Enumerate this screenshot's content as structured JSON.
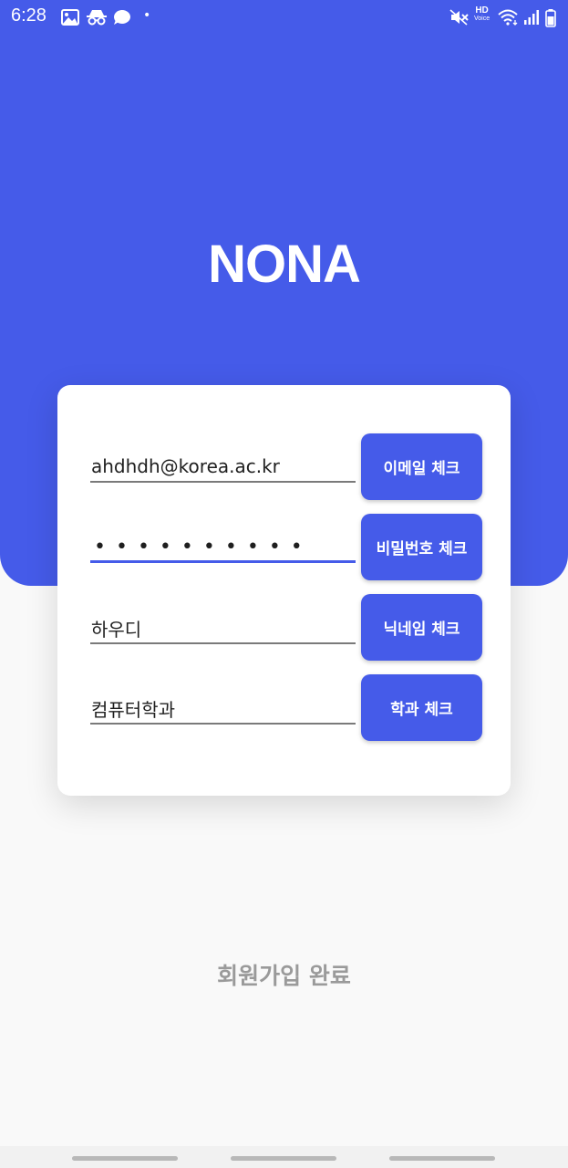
{
  "status_bar": {
    "time": "6:28",
    "hd_label": "HD",
    "voice_label": "Voice",
    "icons": [
      "gallery-icon",
      "incognito-icon",
      "chat-bubble-icon",
      "mute-icon",
      "wifi-icon",
      "signal-icon",
      "battery-icon"
    ]
  },
  "app": {
    "title": "NONA",
    "accent_color": "#455be9"
  },
  "form": {
    "email": {
      "value": "ahdhdh@korea.ac.kr",
      "button_label": "이메일 체크"
    },
    "password": {
      "masked_value": "••••••••••",
      "button_label": "비밀번호 체크"
    },
    "nickname": {
      "value": "하우디",
      "button_label": "닉네임 체크"
    },
    "department": {
      "value": "컴퓨터학과",
      "button_label": "학과 체크"
    }
  },
  "complete_button": {
    "label": "회원가입 완료"
  }
}
